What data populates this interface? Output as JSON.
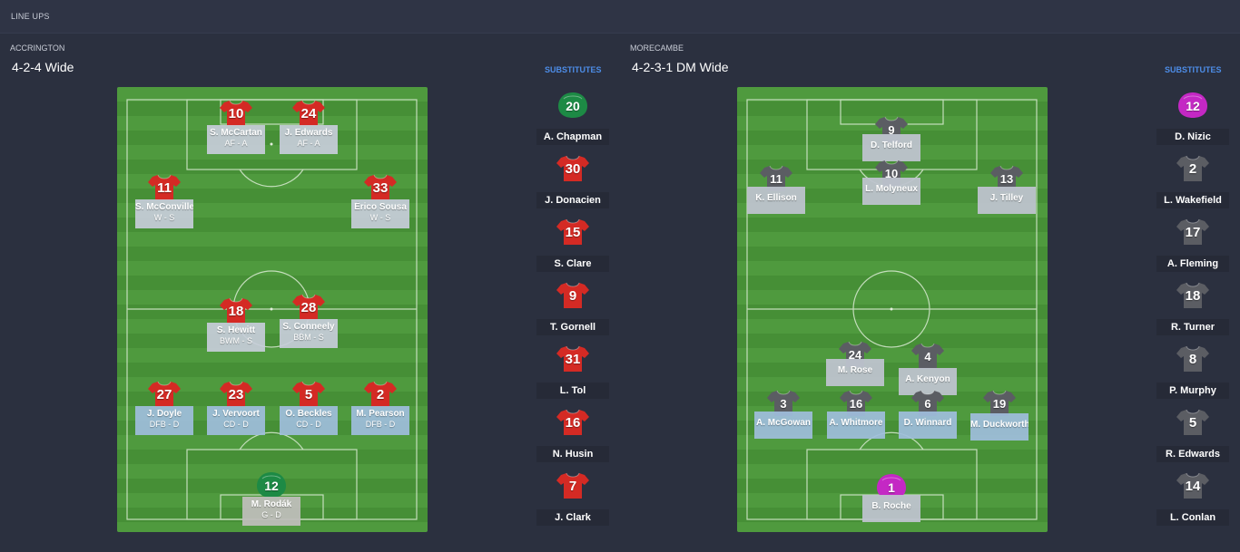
{
  "header": {
    "title": "LINE UPS"
  },
  "home": {
    "team": "ACCRINGTON",
    "formation": "4-2-4 Wide",
    "subs_heading": "SUBSTITUTES",
    "players": [
      {
        "number": "10",
        "name": "S. McCartan",
        "role": "AF - A",
        "kind": "att"
      },
      {
        "number": "24",
        "name": "J. Edwards",
        "role": "AF - A",
        "kind": "att"
      },
      {
        "number": "11",
        "name": "S. McConville",
        "role": "W - S",
        "kind": "att"
      },
      {
        "number": "33",
        "name": "Érico Sousa",
        "role": "W - S",
        "kind": "att"
      },
      {
        "number": "18",
        "name": "S. Hewitt",
        "role": "BWM - S",
        "kind": "mid"
      },
      {
        "number": "28",
        "name": "S. Conneely",
        "role": "BBM - S",
        "kind": "mid"
      },
      {
        "number": "27",
        "name": "J. Doyle",
        "role": "DFB - D",
        "kind": "def"
      },
      {
        "number": "23",
        "name": "J. Vervoort",
        "role": "CD - D",
        "kind": "def"
      },
      {
        "number": "5",
        "name": "O. Beckles",
        "role": "CD - D",
        "kind": "def"
      },
      {
        "number": "2",
        "name": "M. Pearson",
        "role": "DFB - D",
        "kind": "def"
      },
      {
        "number": "12",
        "name": "M. Rodák",
        "role": "G - D",
        "kind": "gk"
      }
    ],
    "subs": [
      {
        "number": "20",
        "name": "A. Chapman",
        "kit": "gk"
      },
      {
        "number": "30",
        "name": "J. Donacien",
        "kit": "red"
      },
      {
        "number": "15",
        "name": "S. Clare",
        "kit": "red"
      },
      {
        "number": "9",
        "name": "T. Gornell",
        "kit": "red"
      },
      {
        "number": "31",
        "name": "L. Tol",
        "kit": "red"
      },
      {
        "number": "16",
        "name": "N. Husin",
        "kit": "red"
      },
      {
        "number": "7",
        "name": "J. Clark",
        "kit": "red"
      }
    ]
  },
  "away": {
    "team": "MORECAMBE",
    "formation": "4-2-3-1 DM Wide",
    "subs_heading": "SUBSTITUTES",
    "players": [
      {
        "number": "9",
        "name": "D. Telford",
        "role": "",
        "kind": "att"
      },
      {
        "number": "10",
        "name": "L. Molyneux",
        "role": "",
        "kind": "att"
      },
      {
        "number": "11",
        "name": "K. Ellison",
        "role": "",
        "kind": "att"
      },
      {
        "number": "13",
        "name": "J. Tilley",
        "role": "",
        "kind": "att"
      },
      {
        "number": "24",
        "name": "M. Rose",
        "role": "",
        "kind": "mid"
      },
      {
        "number": "4",
        "name": "A. Kenyon",
        "role": "",
        "kind": "mid"
      },
      {
        "number": "3",
        "name": "A. McGowan",
        "role": "",
        "kind": "def"
      },
      {
        "number": "16",
        "name": "A. Whitmore",
        "role": "",
        "kind": "def"
      },
      {
        "number": "6",
        "name": "D. Winnard",
        "role": "",
        "kind": "def"
      },
      {
        "number": "19",
        "name": "M. Duckworth",
        "role": "",
        "kind": "def"
      },
      {
        "number": "1",
        "name": "B. Roche",
        "role": "",
        "kind": "gk"
      }
    ],
    "subs": [
      {
        "number": "12",
        "name": "D. Nizic",
        "kit": "gk"
      },
      {
        "number": "2",
        "name": "L. Wakefield",
        "kit": "grey"
      },
      {
        "number": "17",
        "name": "A. Fleming",
        "kit": "grey"
      },
      {
        "number": "18",
        "name": "R. Turner",
        "kit": "grey"
      },
      {
        "number": "8",
        "name": "P. Murphy",
        "kit": "grey"
      },
      {
        "number": "5",
        "name": "R. Edwards",
        "kit": "grey"
      },
      {
        "number": "14",
        "name": "L. Conlan",
        "kit": "grey"
      }
    ]
  },
  "colors": {
    "home_kit": "#d42a24",
    "home_gk_kit": "#1d8a45",
    "away_kit": "#5b5d63",
    "away_gk_kit": "#c428c4",
    "subs_heading": "#4d8de8"
  }
}
